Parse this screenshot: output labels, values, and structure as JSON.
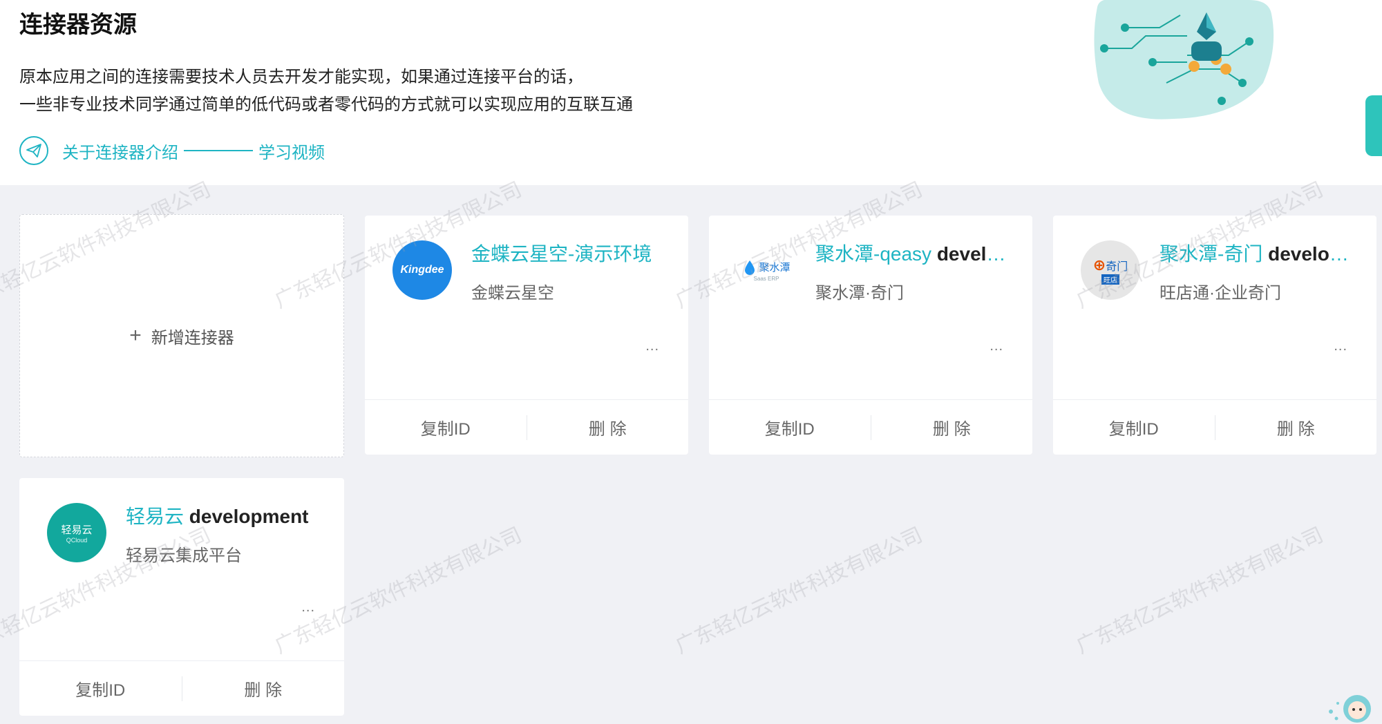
{
  "header": {
    "title": "连接器资源",
    "desc_line1": "原本应用之间的连接需要技术人员去开发才能实现，如果通过连接平台的话，",
    "desc_line2": "一些非专业技术同学通过简单的低代码或者零代码的方式就可以实现应用的互联互通",
    "intro_link": "关于连接器介绍",
    "video_link": "学习视频"
  },
  "watermark_text": "广东轻亿云软件科技有限公司",
  "add_card": {
    "label": "新增连接器",
    "plus": "+"
  },
  "cards": [
    {
      "title_main": "金蝶云星空-演示环境",
      "title_env": "",
      "subtitle": "金蝶云星空",
      "logo_text": "Kingdee",
      "logo_color": "#1e88e5",
      "more": "...",
      "copy_label": "复制ID",
      "delete_label": "删 除"
    },
    {
      "title_main": "聚水潭-qeasy",
      "title_env": " development",
      "subtitle": "聚水潭·奇门",
      "logo_text": "聚水潭",
      "logo_sub": "Saas ERP",
      "logo_color": "#1976d2",
      "more": "...",
      "copy_label": "复制ID",
      "delete_label": "删 除"
    },
    {
      "title_main": "聚水潭-奇门",
      "title_env": " development",
      "subtitle": "旺店通·企业奇门",
      "logo_text": "奇门",
      "logo_sub": "旺店",
      "logo_color": "#e0e0e0",
      "more": "...",
      "copy_label": "复制ID",
      "delete_label": "删 除"
    },
    {
      "title_main": "轻易云",
      "title_env": " development",
      "subtitle": "轻易云集成平台",
      "logo_text": "轻易云",
      "logo_sub": "QCloud",
      "logo_color": "#12a89d",
      "more": "...",
      "copy_label": "复制ID",
      "delete_label": "删 除"
    }
  ],
  "colors": {
    "accent": "#1eb4c3",
    "background": "#f0f1f5",
    "side_tab": "#2ec4bb"
  }
}
